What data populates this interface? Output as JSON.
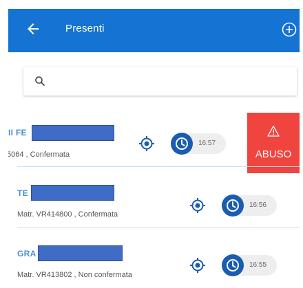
{
  "header": {
    "title": "Presenti",
    "back_icon": "arrow-left-icon",
    "add_icon": "plus-circle-icon",
    "background_color": "#1573d3"
  },
  "search": {
    "placeholder": "",
    "icon": "search-icon"
  },
  "rows": [
    {
      "name": "II FE",
      "detail": "5064 , Confermata",
      "time": "16:57",
      "swipe_action": "ABUSO"
    },
    {
      "name": "TE",
      "detail": "Matr. VR414800 , Confermata",
      "time": "16:56"
    },
    {
      "name": "GRA",
      "detail": "Matr. VR413802 , Non confermata",
      "time": "16:55"
    }
  ],
  "colors": {
    "accent": "#1573d3",
    "clock": "#1a5cb0",
    "abuse": "#f0443f",
    "name": "#4a8fd4"
  }
}
